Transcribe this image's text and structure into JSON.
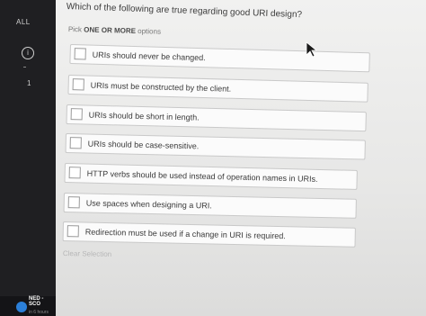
{
  "sidebar": {
    "filter_label": "ALL",
    "info_glyph": "i",
    "item_number": "1",
    "account_name": "NED - SCO",
    "account_sub": "in 6 hours"
  },
  "question": {
    "text": "Which of the following are true regarding good URI design?"
  },
  "instructions": {
    "prefix": "Pick",
    "emphasis": "ONE OR MORE",
    "suffix": "options"
  },
  "options": [
    {
      "label": "URIs should never be changed.",
      "checked": false
    },
    {
      "label": "URIs must be constructed by the client.",
      "checked": false
    },
    {
      "label": "URIs should be short in length.",
      "checked": false
    },
    {
      "label": "URIs should be case-sensitive.",
      "checked": false
    },
    {
      "label": "HTTP verbs should be used instead of operation names in URIs.",
      "checked": false
    },
    {
      "label": "Use spaces when designing a URI.",
      "checked": false
    },
    {
      "label": "Redirection must be used if a change in URI is required.",
      "checked": false
    }
  ],
  "clear_selection_label": "Clear Selection",
  "icons": {
    "info": "info-circle-icon",
    "cursor": "mouse-pointer-icon",
    "avatar": "account-avatar-icon"
  }
}
